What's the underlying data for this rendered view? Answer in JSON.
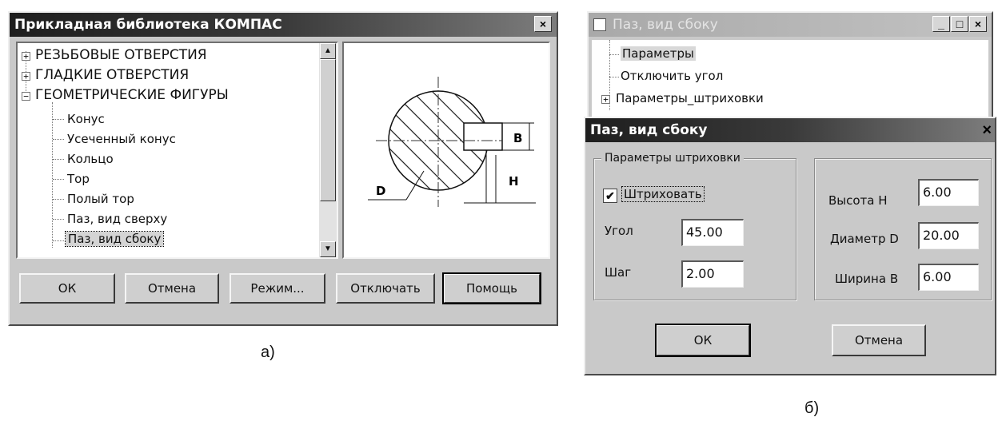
{
  "dialog_a": {
    "title": "Прикладная библиотека КОМПАС",
    "close_glyph": "×",
    "tree": {
      "groups": [
        {
          "label": "РЕЗЬБОВЫЕ ОТВЕРСТИЯ",
          "expander": "+"
        },
        {
          "label": "ГЛАДКИЕ ОТВЕРСТИЯ",
          "expander": "+"
        },
        {
          "label": "ГЕОМЕТРИЧЕСКИЕ ФИГУРЫ",
          "expander": "−"
        }
      ],
      "items": [
        "Конус",
        "Усеченный конус",
        "Кольцо",
        "Тор",
        "Полый тор",
        "Паз, вид сверху",
        "Паз, вид сбоку"
      ],
      "selected": "Паз, вид сбоку"
    },
    "preview": {
      "label_b": "B",
      "label_d": "D",
      "label_h": "H"
    },
    "buttons": {
      "ok": "ОК",
      "cancel": "Отмена",
      "mode": "Режим...",
      "disable": "Отключать",
      "help": "Помощь"
    }
  },
  "caption_a": "а)",
  "window_b": {
    "title": "Паз, вид сбоку",
    "controls": {
      "minimize": "_",
      "maximize": "□",
      "close": "×"
    },
    "tree": {
      "items": [
        "Параметры",
        "Отключить угол"
      ],
      "expandable_item": "Параметры_штриховки",
      "expander": "+"
    }
  },
  "dialog_b": {
    "title": "Паз, вид сбоку",
    "close_glyph": "×",
    "hatch_group": {
      "title": "Параметры штриховки",
      "checkbox_label": "Штриховать",
      "checkbox_mark": "✔",
      "angle_label": "Угол",
      "angle_value": "45.00",
      "step_label": "Шаг",
      "step_value": "2.00"
    },
    "dims_group": {
      "height_label": "Высота Н",
      "height_value": "6.00",
      "diameter_label": "Диаметр D",
      "diameter_value": "20.00",
      "width_label": "Ширина В",
      "width_value": "6.00"
    },
    "buttons": {
      "ok": "ОК",
      "cancel": "Отмена"
    }
  },
  "caption_b": "б)"
}
